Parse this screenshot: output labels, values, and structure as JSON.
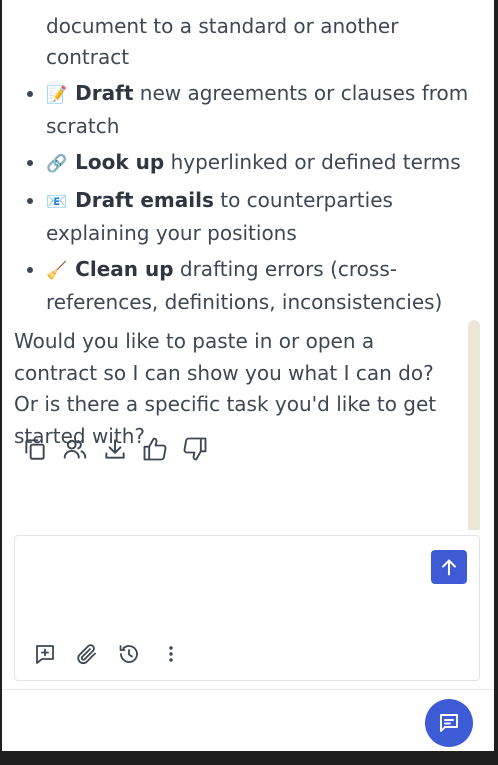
{
  "continued_text": "document to a standard or another contract",
  "features": [
    {
      "icon": "memo-emoji",
      "glyph": "📝",
      "bold": "Draft",
      "rest": " new agreements or clauses from scratch"
    },
    {
      "icon": "link-emoji",
      "glyph": "🔗",
      "bold": "Look up",
      "rest": " hyperlinked or defined terms"
    },
    {
      "icon": "email-emoji",
      "glyph": "📧",
      "bold": "Draft emails",
      "rest": " to counterparties explaining your positions"
    },
    {
      "icon": "broom-emoji",
      "glyph": "🧹",
      "bold": "Clean up",
      "rest": " drafting errors (cross-references, definitions, inconsistencies)"
    }
  ],
  "message": "Would you like to paste in or open a contract so I can show you what I can do? Or is there a specific task you'd like to get started with?",
  "message_actions": [
    "copy-icon",
    "users-icon",
    "download-icon",
    "thumbs-up-icon",
    "thumbs-down-icon"
  ],
  "composer": {
    "value": "",
    "placeholder": ""
  },
  "composer_tools": [
    "add-box-icon",
    "paperclip-icon",
    "history-icon",
    "more-vertical-icon"
  ],
  "colors": {
    "accent": "#3e5bd6",
    "text": "#3f4754",
    "scrollbar": "#ece6d8"
  }
}
